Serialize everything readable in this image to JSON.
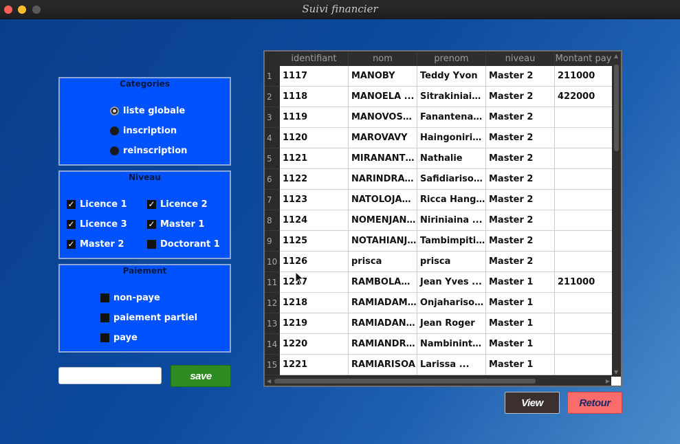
{
  "window": {
    "title": "Suivi financier"
  },
  "categories": {
    "title": "Categories",
    "options": [
      {
        "label": "liste globale",
        "selected": true
      },
      {
        "label": "inscription",
        "selected": false
      },
      {
        "label": "reinscription",
        "selected": false
      }
    ]
  },
  "niveau": {
    "title": "Niveau",
    "options": [
      {
        "label": "Licence 1",
        "checked": true
      },
      {
        "label": "Licence 2",
        "checked": true
      },
      {
        "label": "Licence 3",
        "checked": true
      },
      {
        "label": "Master 1",
        "checked": true
      },
      {
        "label": "Master 2",
        "checked": true
      },
      {
        "label": "Doctorant 1",
        "checked": false
      }
    ]
  },
  "paiement": {
    "title": "Paiement",
    "options": [
      {
        "label": "non-paye",
        "checked": false
      },
      {
        "label": "paiement partiel",
        "checked": false
      },
      {
        "label": "paye",
        "checked": false
      }
    ]
  },
  "form": {
    "input_value": "",
    "save_label": "save"
  },
  "actions": {
    "view_label": "View",
    "retour_label": "Retour"
  },
  "table": {
    "columns": [
      "identifiant",
      "nom",
      "prenom",
      "niveau",
      "Montant pay"
    ],
    "rows": [
      {
        "num": "1",
        "cells": [
          "1117",
          "MANOBY",
          "Teddy Yvon",
          "Master 2",
          "211000"
        ]
      },
      {
        "num": "2",
        "cells": [
          "1118",
          "MANOELA ...",
          "Sitrakiniaina ...",
          "Master 2",
          "422000"
        ]
      },
      {
        "num": "3",
        "cells": [
          "1119",
          "MANOVOSOA...",
          "Fanantenana...",
          "Master 2",
          ""
        ]
      },
      {
        "num": "4",
        "cells": [
          "1120",
          "MAROVAVY",
          "Haingonirina ...",
          "Master 2",
          ""
        ]
      },
      {
        "num": "5",
        "cells": [
          "1121",
          "MIRANANTEN...",
          "Nathalie",
          "Master 2",
          ""
        ]
      },
      {
        "num": "6",
        "cells": [
          "1122",
          "NARINDRANI...",
          "Safidiarisoa ...",
          "Master 2",
          ""
        ]
      },
      {
        "num": "7",
        "cells": [
          "1123",
          "NATOLOJAN...",
          "Ricca Hangson",
          "Master 2",
          ""
        ]
      },
      {
        "num": "8",
        "cells": [
          "1124",
          "NOMENJANA...",
          "Niriniaina ...",
          "Master 2",
          ""
        ]
      },
      {
        "num": "9",
        "cells": [
          "1125",
          "NOTAHIANJA...",
          "Tambimpitiav...",
          "Master 2",
          ""
        ]
      },
      {
        "num": "10",
        "cells": [
          "1126",
          "prisca",
          "prisca",
          "Master 2",
          ""
        ]
      },
      {
        "num": "11",
        "cells": [
          "1217",
          "RAMBOLAMA...",
          "Jean Yves ...",
          "Master 1",
          "211000"
        ]
      },
      {
        "num": "12",
        "cells": [
          "1218",
          "RAMIADAMAL...",
          "Onjaharisoa ...",
          "Master 1",
          ""
        ]
      },
      {
        "num": "13",
        "cells": [
          "1219",
          "RAMIADANAR...",
          "Jean Roger",
          "Master 1",
          ""
        ]
      },
      {
        "num": "14",
        "cells": [
          "1220",
          "RAMIANDRIS...",
          "Nambinintso...",
          "Master 1",
          ""
        ]
      },
      {
        "num": "15",
        "cells": [
          "1221",
          "RAMIARISOA",
          "Larissa ...",
          "Master 1",
          ""
        ]
      }
    ]
  }
}
